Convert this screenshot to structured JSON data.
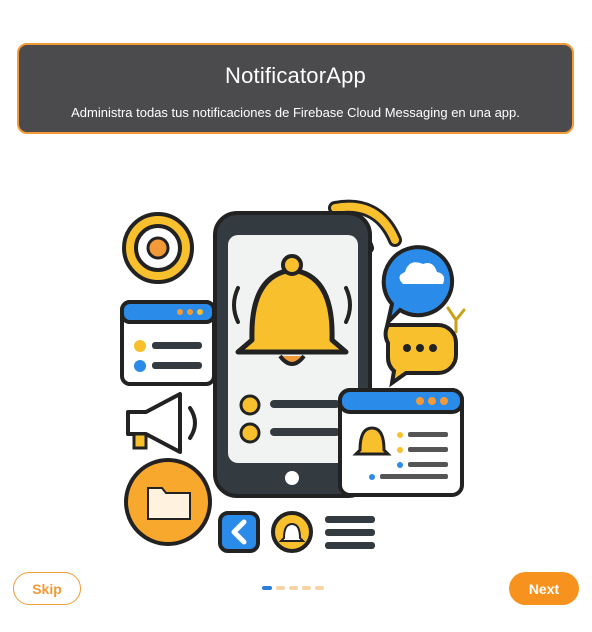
{
  "header": {
    "title": "NotificatorApp",
    "subtitle": "Administra todas tus notificaciones de Firebase Cloud Messaging en una app."
  },
  "illustration": {
    "icons": [
      "phone-icon",
      "bell-icon",
      "wifi-signal-icon",
      "target-icon",
      "cloud-chat-icon",
      "chat-bubble-icon",
      "megaphone-icon",
      "folder-icon",
      "back-arrow-icon",
      "window-icon",
      "sparkle-icon"
    ]
  },
  "pagination": {
    "total": 5,
    "active_index": 0
  },
  "buttons": {
    "skip_label": "Skip",
    "next_label": "Next"
  },
  "colors": {
    "accent": "#f7921e",
    "header_bg": "#4b4b4d",
    "active_dot": "#2b7fd9"
  }
}
